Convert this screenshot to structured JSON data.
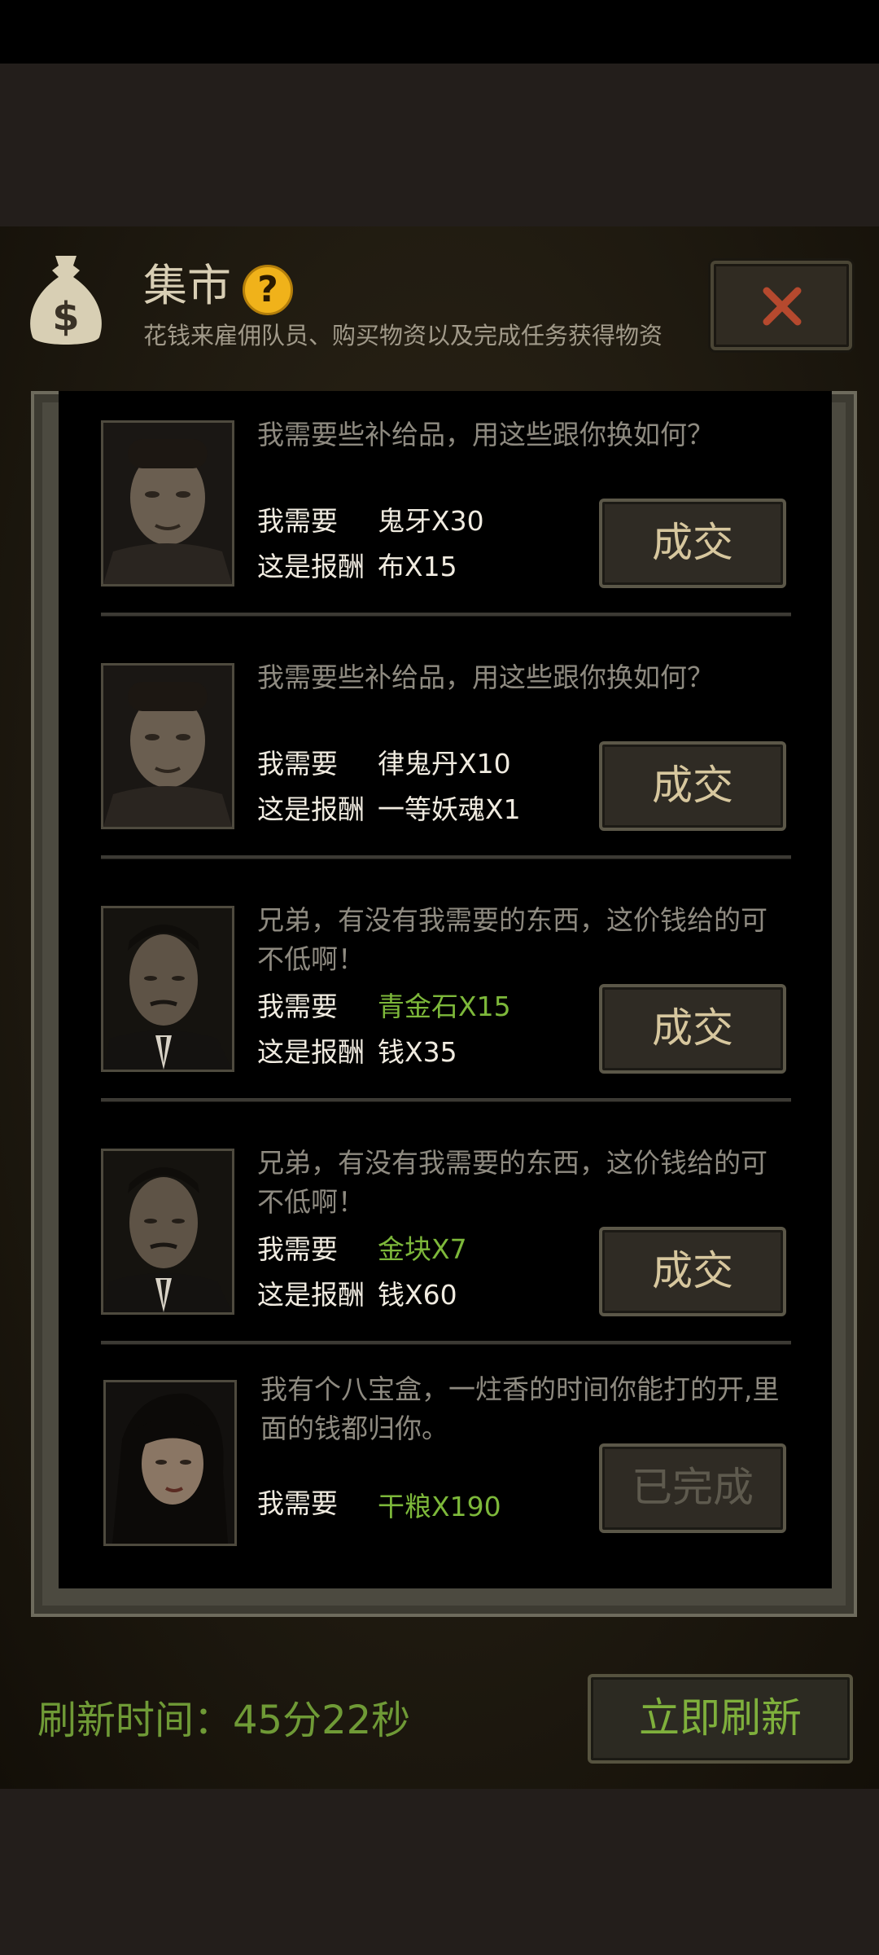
{
  "header": {
    "title": "集市",
    "help_glyph": "?",
    "subtitle": "花钱来雇佣队员、购买物资以及完成任务获得物资",
    "icon": "money-bag-icon",
    "close_icon": "close-x-icon"
  },
  "labels": {
    "need": "我需要",
    "reward": "这是报酬"
  },
  "trades": [
    {
      "portrait": "man-portrait-1",
      "quote": "我需要些补给品，用这些跟你换如何？",
      "need_value": "鬼牙X30",
      "need_highlight": false,
      "reward_value": "布X15",
      "button": "成交",
      "completed": false
    },
    {
      "portrait": "man-portrait-1",
      "quote": "我需要些补给品，用这些跟你换如何？",
      "need_value": "律鬼丹X10",
      "need_highlight": false,
      "reward_value": "一等妖魂X1",
      "button": "成交",
      "completed": false
    },
    {
      "portrait": "man-portrait-2",
      "quote": "兄弟，有没有我需要的东西，这价钱给的可不低啊！",
      "need_value": "青金石X15",
      "need_highlight": true,
      "reward_value": "钱X35",
      "button": "成交",
      "completed": false
    },
    {
      "portrait": "man-portrait-2",
      "quote": "兄弟，有没有我需要的东西，这价钱给的可不低啊！",
      "need_value": "金块X7",
      "need_highlight": true,
      "reward_value": "钱X60",
      "button": "成交",
      "completed": false
    },
    {
      "portrait": "woman-portrait",
      "quote": "我有个八宝盒，一炷香的时间你能打的开,里面的钱都归你。",
      "need_value": "干粮X190",
      "need_highlight": true,
      "reward_value": "",
      "button": "已完成",
      "completed": true
    }
  ],
  "footer": {
    "refresh_timer": "刷新时间：45分22秒",
    "refresh_button": "立即刷新"
  },
  "colors": {
    "highlight_green": "#7db83a",
    "button_text": "#d7c79e",
    "help_icon": "#f0b21a",
    "close_x": "#b5492e"
  }
}
